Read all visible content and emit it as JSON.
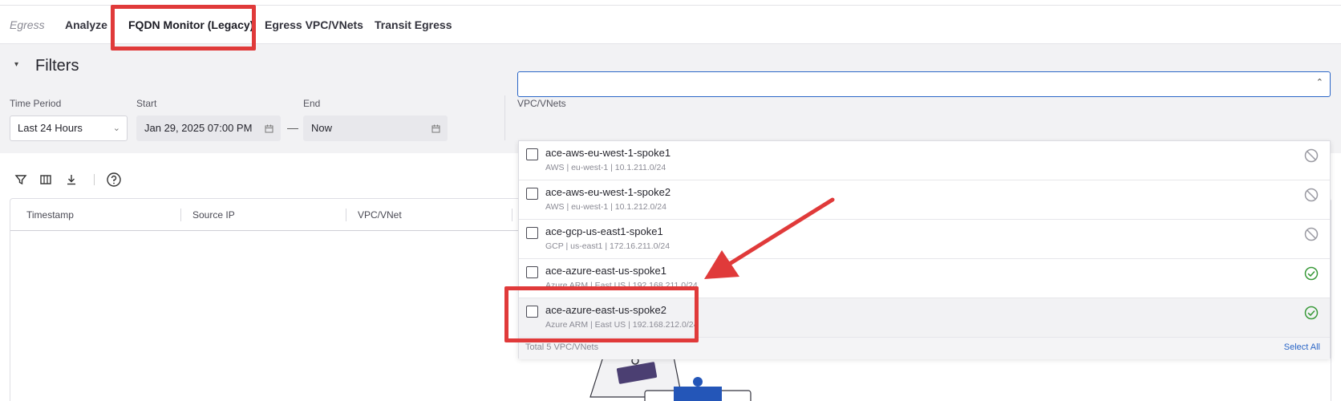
{
  "tabs": {
    "context": "Egress",
    "items": [
      {
        "label": "Analyze"
      },
      {
        "label": "FQDN Monitor (Legacy)"
      },
      {
        "label": "Egress VPC/VNets"
      },
      {
        "label": "Transit Egress"
      }
    ]
  },
  "filters": {
    "title": "Filters",
    "time_period": {
      "label": "Time Period",
      "value": "Last 24 Hours"
    },
    "start": {
      "label": "Start",
      "value": "Jan 29, 2025 07:00 PM"
    },
    "end": {
      "label": "End",
      "value": "Now"
    },
    "separator": "—",
    "vpc": {
      "label": "VPC/VNets",
      "value": ""
    }
  },
  "toolbar": {
    "icons": [
      "filter-icon",
      "columns-icon",
      "download-icon",
      "help-icon"
    ]
  },
  "table": {
    "columns": [
      "Timestamp",
      "Source IP",
      "VPC/VNet"
    ]
  },
  "dropdown": {
    "options": [
      {
        "name": "ace-aws-eu-west-1-spoke1",
        "detail": "AWS | eu-west-1 | 10.1.211.0/24",
        "status": "disabled"
      },
      {
        "name": "ace-aws-eu-west-1-spoke2",
        "detail": "AWS | eu-west-1 | 10.1.212.0/24",
        "status": "disabled"
      },
      {
        "name": "ace-gcp-us-east1-spoke1",
        "detail": "GCP | us-east1 | 172.16.211.0/24",
        "status": "disabled"
      },
      {
        "name": "ace-azure-east-us-spoke1",
        "detail": "Azure ARM | East US | 192.168.211.0/24",
        "status": "enabled"
      },
      {
        "name": "ace-azure-east-us-spoke2",
        "detail": "Azure ARM | East US | 192.168.212.0/24",
        "status": "enabled"
      }
    ],
    "total": "Total 5 VPC/VNets",
    "select_all": "Select All"
  },
  "colors": {
    "accent": "#2b66c7",
    "highlight": "#e03a3a",
    "enabled": "#3a9a3a",
    "disabled": "#9a9aa2"
  }
}
